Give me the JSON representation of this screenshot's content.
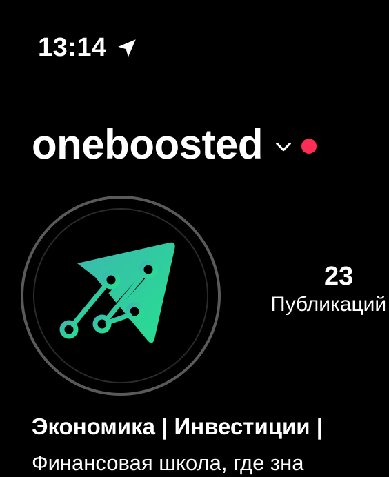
{
  "status_bar": {
    "time": "13:14",
    "location_icon": "location-arrow-icon"
  },
  "profile": {
    "username": "oneboosted",
    "switch_icon": "chevron-down-icon",
    "notification_color": "#ff2d55",
    "avatar_icon": "oneboosted-logo-icon"
  },
  "stats": {
    "posts_count": "23",
    "posts_label": "Публикаций"
  },
  "bio": {
    "title": "Экономика | Инвестиции |",
    "text": "Финансовая школа, где зна"
  },
  "colors": {
    "background": "#000000",
    "text": "#ffffff",
    "logo_gradient_start": "#3bb8b0",
    "logo_gradient_end": "#27e08f"
  }
}
